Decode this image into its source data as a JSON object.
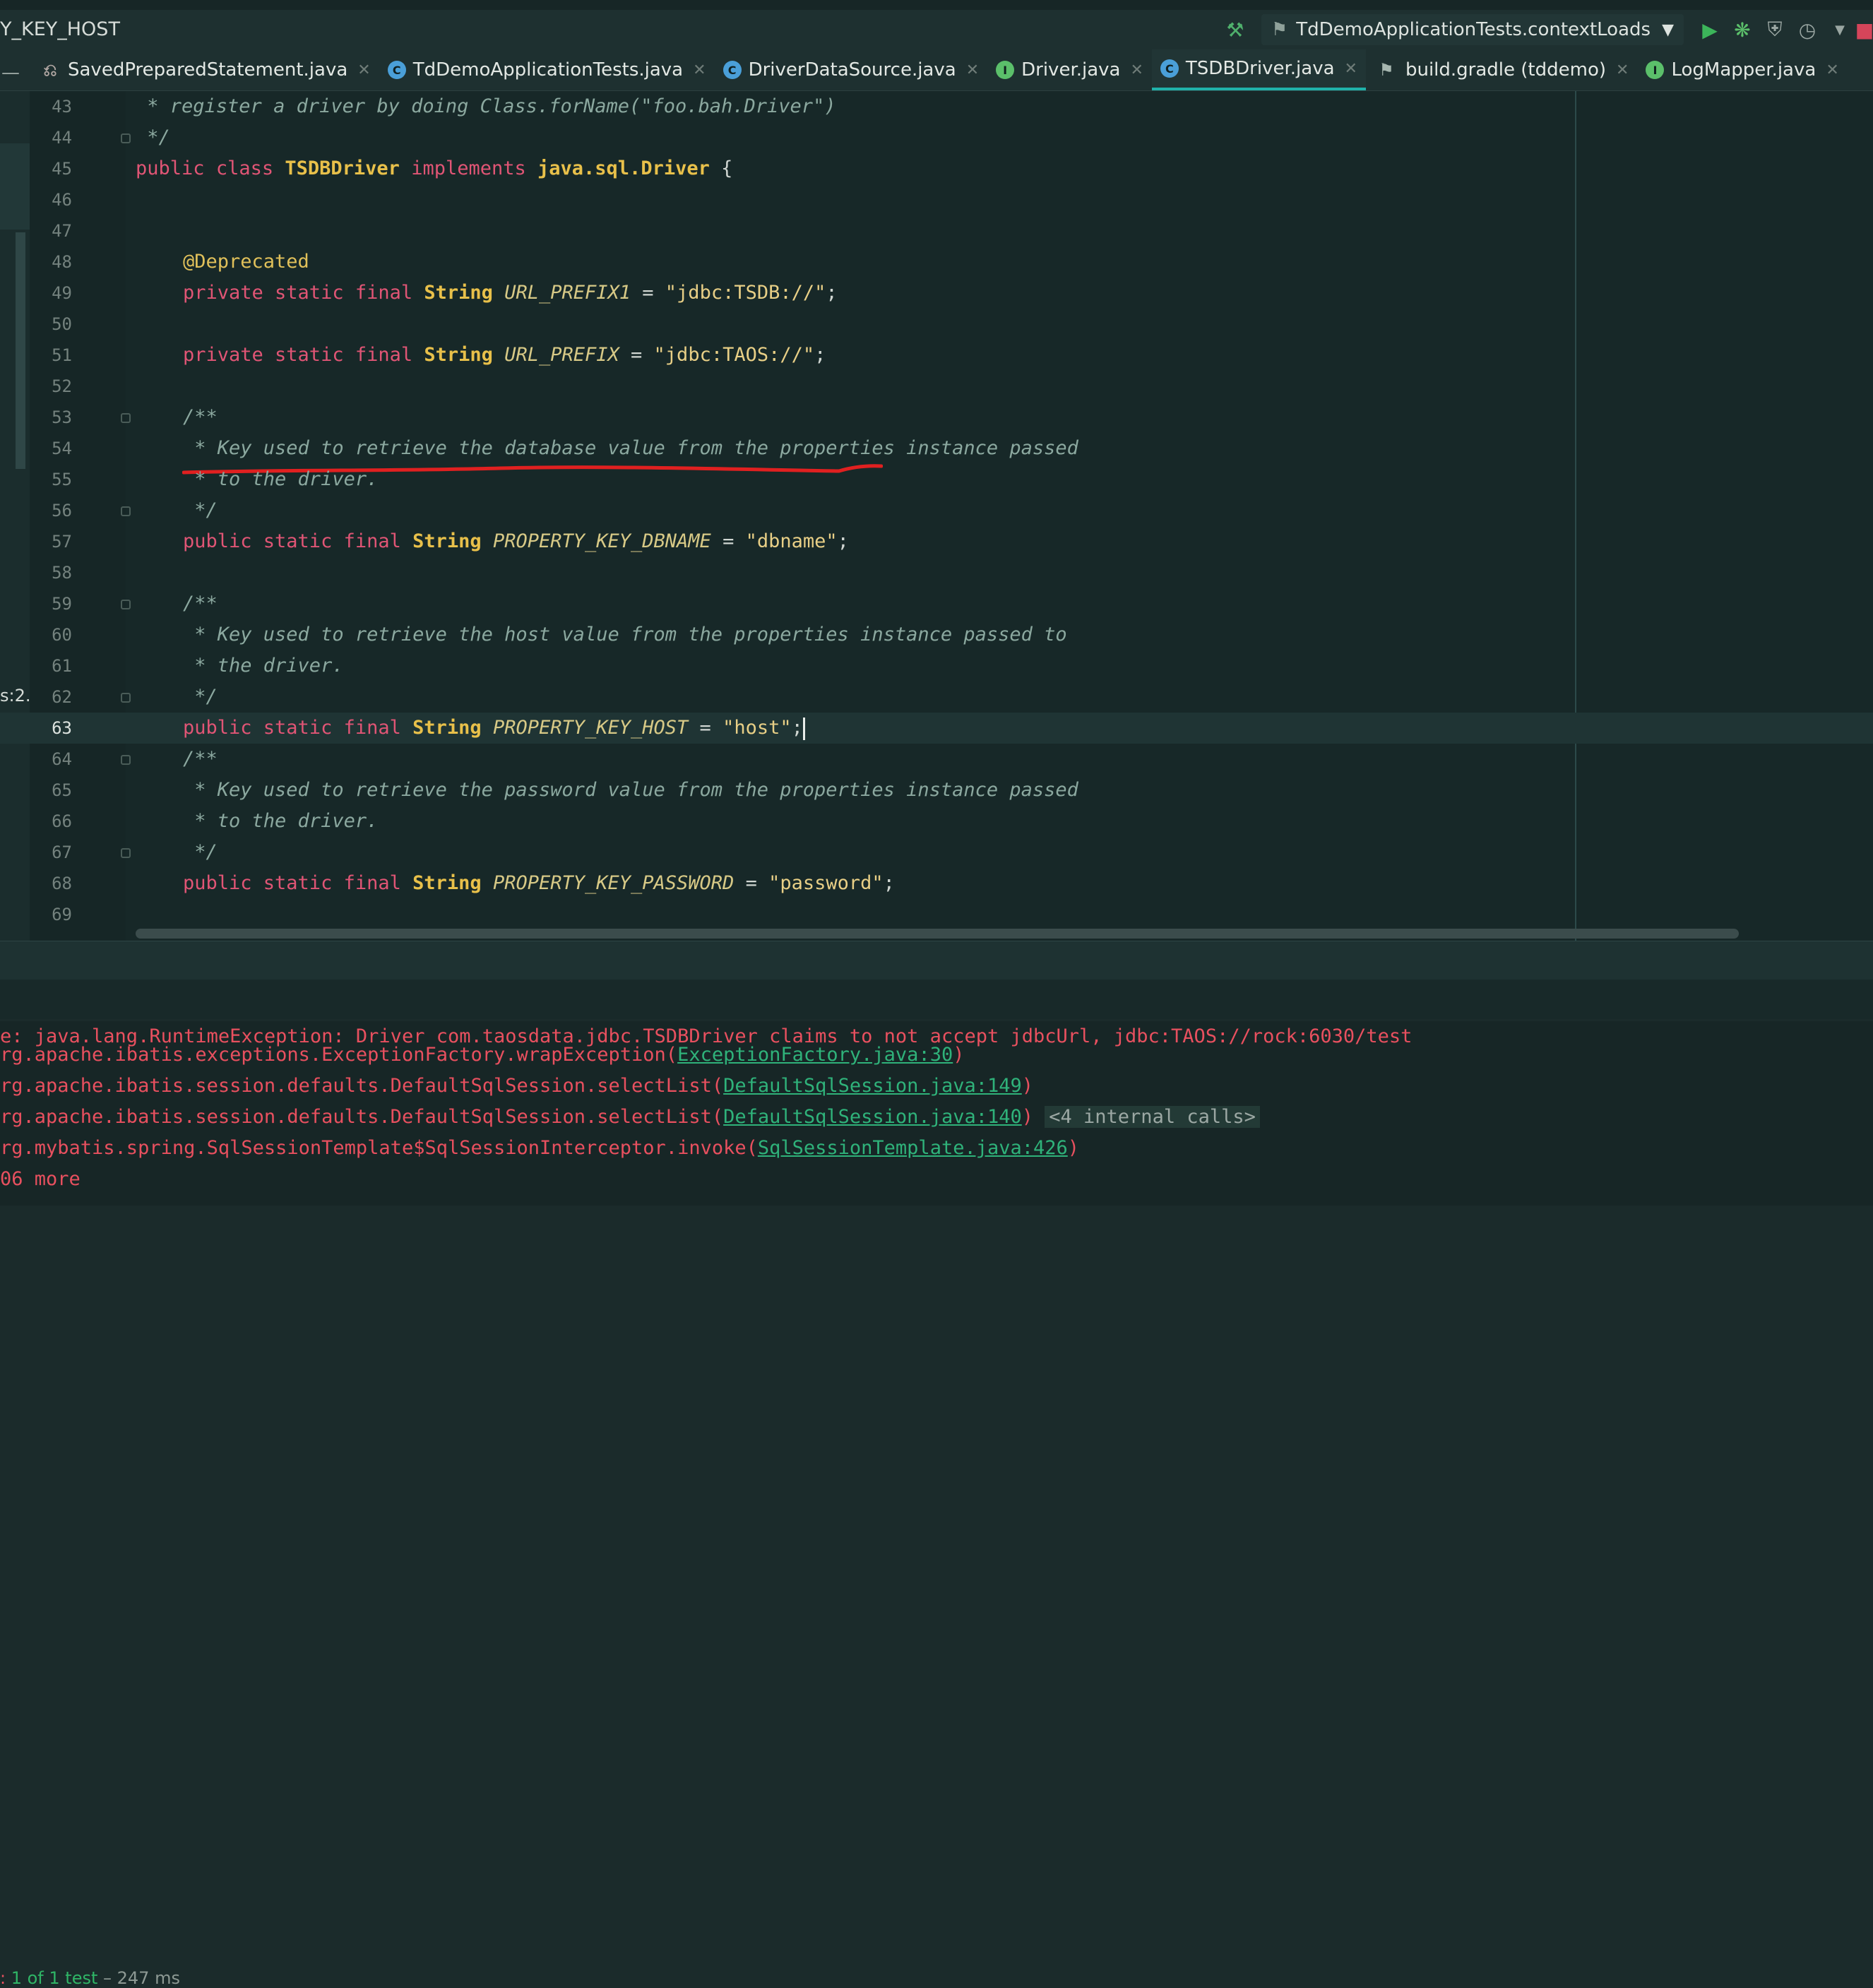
{
  "breadcrumb": "Y_KEY_HOST",
  "run_config": {
    "label": "TdDemoApplicationTests.contextLoads",
    "icons": [
      "hammer-icon",
      "run-icon",
      "debug-icon",
      "coverage-icon",
      "profile-icon"
    ]
  },
  "tabs": [
    {
      "label": "SavedPreparedStatement.java",
      "icon": "db-class-icon",
      "active": false
    },
    {
      "label": "TdDemoApplicationTests.java",
      "icon": "class-icon",
      "active": false
    },
    {
      "label": "DriverDataSource.java",
      "icon": "class-icon",
      "active": false
    },
    {
      "label": "Driver.java",
      "icon": "interface-icon",
      "active": false
    },
    {
      "label": "TSDBDriver.java",
      "icon": "class-icon",
      "active": true
    },
    {
      "label": "build.gradle (tddemo)",
      "icon": "gradle-icon",
      "active": false
    },
    {
      "label": "LogMapper.java",
      "icon": "interface-icon",
      "active": false
    }
  ],
  "line_numbers": [
    "43",
    "44",
    "45",
    "46",
    "47",
    "48",
    "49",
    "50",
    "51",
    "52",
    "53",
    "54",
    "55",
    "56",
    "57",
    "58",
    "59",
    "60",
    "61",
    "62",
    "63",
    "64",
    "65",
    "66",
    "67",
    "68",
    "69"
  ],
  "current_line": "63",
  "side_text": "s:2.",
  "code": {
    "l43": " * register a driver by doing Class.forName(\"foo.bah.Driver\")",
    "l44": " */",
    "l45_kw1": "public",
    "l45_kw2": "class",
    "l45_name": "TSDBDriver",
    "l45_kw3": "implements",
    "l45_iface": "java.sql.Driver",
    "l45_brace": "{",
    "l48": "@Deprecated",
    "mods_private": "private static final",
    "mods_public": "public static final",
    "type_string": "String",
    "l49_field": "URL_PREFIX1",
    "l49_value": "\"jdbc:TSDB://\"",
    "l51_field": "URL_PREFIX",
    "l51_value": "\"jdbc:TAOS://\"",
    "l53": "/**",
    "l54": " * Key used to retrieve the database value from the properties instance passed",
    "l55": " * to the driver.",
    "l56": " */",
    "l57_field": "PROPERTY_KEY_DBNAME",
    "l57_value": "\"dbname\"",
    "l59": "/**",
    "l60": " * Key used to retrieve the host value from the properties instance passed to",
    "l61": " * the driver.",
    "l62": " */",
    "l63_field": "PROPERTY_KEY_HOST",
    "l63_value": "\"host\"",
    "l64": "/**",
    "l65": " * Key used to retrieve the password value from the properties instance passed",
    "l66": " * to the driver.",
    "l67": " */",
    "l68_field": "PROPERTY_KEY_PASSWORD",
    "l68_value": "\"password\"",
    "eq": "=",
    "semi": ";"
  },
  "test_summary": {
    "prefix": ": ",
    "pass": "1 of 1 test",
    "time": " – 247 ms"
  },
  "console": {
    "line1": "e: java.lang.RuntimeException: Driver com.taosdata.jdbc.TSDBDriver claims to not accept jdbcUrl, jdbc:TAOS://rock:6030/test",
    "line2_text": "rg.apache.ibatis.exceptions.ExceptionFactory.wrapException(",
    "line2_link": "ExceptionFactory.java:30",
    "line3_text": "rg.apache.ibatis.session.defaults.DefaultSqlSession.selectList(",
    "line3_link": "DefaultSqlSession.java:149",
    "line4_text": "rg.apache.ibatis.session.defaults.DefaultSqlSession.selectList(",
    "line4_link": "DefaultSqlSession.java:140",
    "line4_extra": "<4 internal calls>",
    "line5_text": "rg.mybatis.spring.SqlSessionTemplate$SqlSessionInterceptor.invoke(",
    "line5_link": "SqlSessionTemplate.java:426",
    "line6": "06 more",
    "close_paren": ")"
  },
  "colors": {
    "accent": "#20b2aa",
    "keyword": "#e05575",
    "error": "#e8505f",
    "pass": "#2fb566"
  }
}
